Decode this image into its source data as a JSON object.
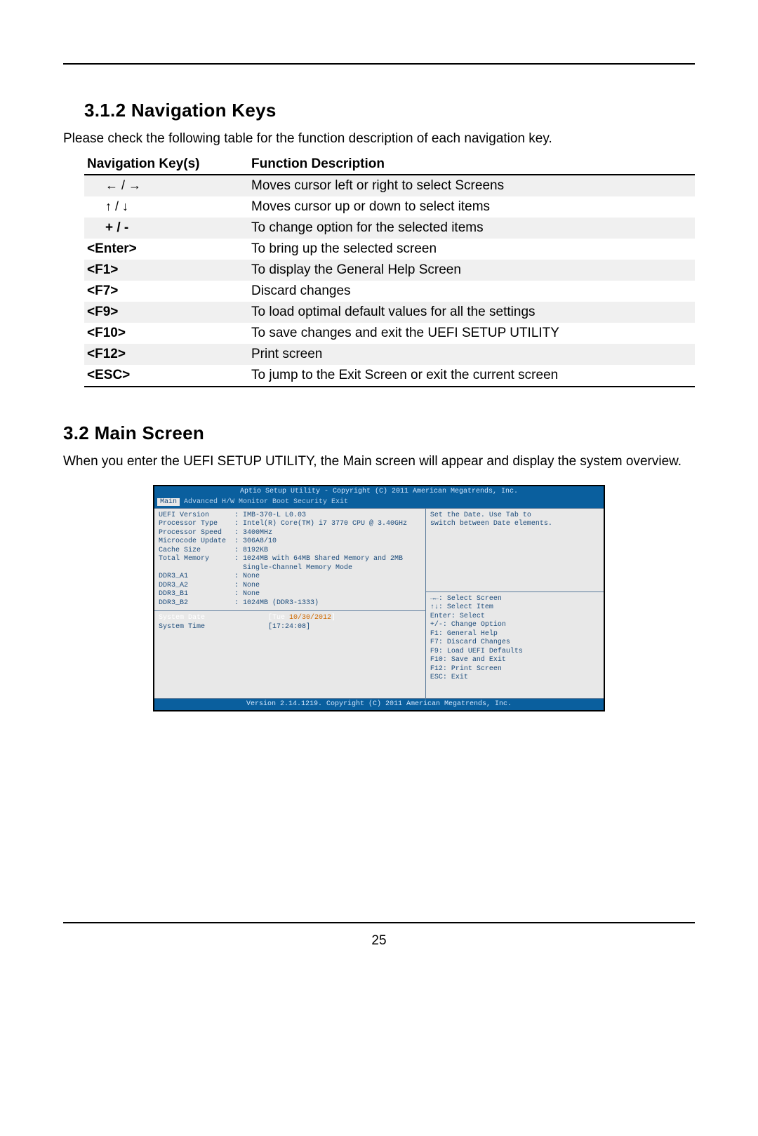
{
  "section1": {
    "heading": "3.1.2  Navigation Keys",
    "intro": "Please check the following table for the function description of each navigation key.",
    "col1": "Navigation Key(s)",
    "col2": "Function Description",
    "rows": [
      {
        "key": "← / →",
        "desc": "Moves cursor left or right to select Screens",
        "arrow": true
      },
      {
        "key": "↑ / ↓",
        "desc": "Moves cursor up or down to select items",
        "arrow": true
      },
      {
        "key": "+  /  -",
        "desc": "To change option for the selected items"
      },
      {
        "key": "<Enter>",
        "desc": "To bring up the selected screen"
      },
      {
        "key": "<F1>",
        "desc": "To display the General Help Screen"
      },
      {
        "key": "<F7>",
        "desc": "Discard changes"
      },
      {
        "key": "<F9>",
        "desc": "To load optimal default values for all the settings"
      },
      {
        "key": "<F10>",
        "desc": "To save changes and exit the UEFI SETUP UTILITY"
      },
      {
        "key": "<F12>",
        "desc": "Print screen"
      },
      {
        "key": "<ESC>",
        "desc": "To jump to the Exit Screen or exit the current screen"
      }
    ]
  },
  "section2": {
    "heading": "3.2  Main Screen",
    "intro": "When you enter the UEFI SETUP UTILITY, the Main screen will appear and display the system overview."
  },
  "bios": {
    "title": "Aptio Setup Utility - Copyright (C) 2011 American Megatrends, Inc.",
    "menu_active": "Main",
    "menu_rest": " Advanced  H/W Monitor  Boot  Security  Exit",
    "left": [
      "UEFI Version      : IMB-370-L L0.03",
      "Processor Type    : Intel(R) Core(TM) i7 3770 CPU @ 3.40GHz",
      "Processor Speed   : 3400MHz",
      "Microcode Update  : 306A8/10",
      "Cache Size        : 8192KB",
      "",
      "Total Memory      : 1024MB with 64MB Shared Memory and 2MB",
      "                    Single-Channel Memory Mode",
      "DDR3_A1           : None",
      "DDR3_A2           : None",
      "DDR3_B1           : None",
      "DDR3_B2           : 1024MB (DDR3-1333)"
    ],
    "left_date": "System Date               [Tue ",
    "left_date_val": "10/30/2012",
    "left_date_end": "]",
    "left_time": "System Time               [",
    "left_time_val": "17:24:08",
    "left_time_end": "]",
    "right_top": [
      "Set the Date. Use Tab to",
      "switch between Date elements."
    ],
    "right_help": [
      "→←: Select Screen",
      "↑↓: Select Item",
      "Enter: Select",
      "+/-: Change Option",
      "F1: General Help",
      "F7: Discard Changes",
      "F9: Load UEFI Defaults",
      "F10: Save and Exit",
      "F12: Print Screen",
      "ESC: Exit"
    ],
    "footer": "Version 2.14.1219. Copyright (C) 2011 American Megatrends, Inc."
  },
  "pagenum": "25"
}
